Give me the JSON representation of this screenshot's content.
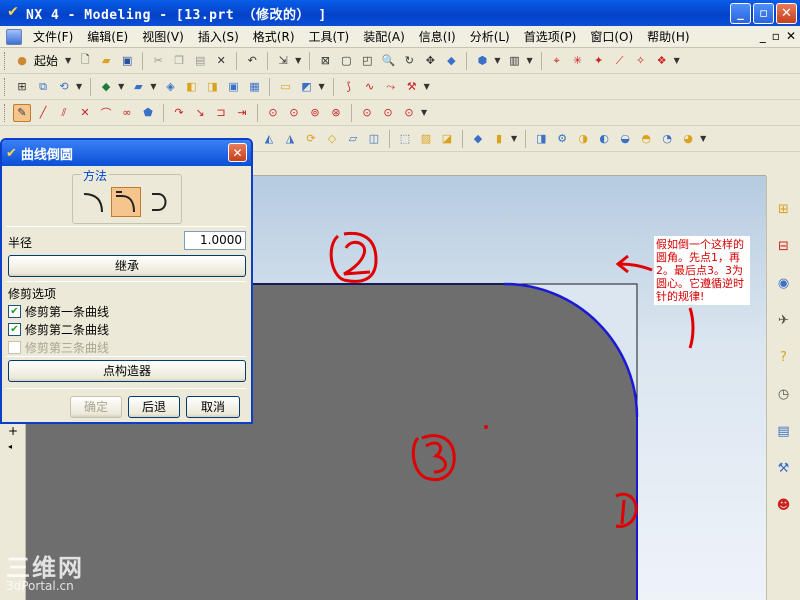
{
  "window": {
    "title": "NX 4 - Modeling - [13.prt （修改的） ]",
    "buttons": {
      "minimize": "_",
      "maximize": "▫",
      "close": "✕"
    }
  },
  "menubar": {
    "items": [
      "文件(F)",
      "编辑(E)",
      "视图(V)",
      "插入(S)",
      "格式(R)",
      "工具(T)",
      "装配(A)",
      "信息(I)",
      "分析(L)",
      "首选项(P)",
      "窗口(O)",
      "帮助(H)"
    ],
    "right_controls": [
      "_",
      "▫",
      "✕"
    ]
  },
  "toolbar": {
    "start_label": "起始"
  },
  "dialog": {
    "title": "曲线倒圆",
    "method_label": "方法",
    "radius_label": "半径",
    "radius_value": "1.0000",
    "inherit_button": "继承",
    "trim_options_label": "修剪选项",
    "trim_first": "修剪第一条曲线",
    "trim_second": "修剪第二条曲线",
    "trim_third": "修剪第三条曲线",
    "point_constructor_button": "点构造器",
    "ok_button": "确定",
    "back_button": "后退",
    "cancel_button": "取消"
  },
  "annotation": {
    "note_text": "假如倒一个这样的圆角。先点1，再2。最后点3。3为圆心。它遵循逆时针的规律!",
    "marker_1": "1",
    "marker_2": "2",
    "marker_3": "3"
  },
  "watermark": {
    "line1": "三维网",
    "line2": "3dPortal.cn"
  },
  "colors": {
    "title_blue": "#0a4fd6",
    "solid_face": "#6e6e6e",
    "fillet_curve": "#1a1ad6",
    "annotation_red": "#d40000",
    "active_method": "#f6c58e"
  }
}
